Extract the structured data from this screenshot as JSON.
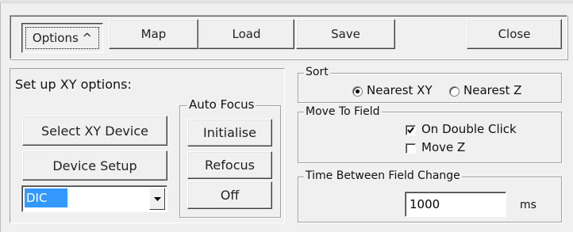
{
  "toolbar": {
    "options_label": "Options ^",
    "map_label": "Map",
    "load_label": "Load",
    "save_label": "Save",
    "close_label": "Close"
  },
  "xy_panel": {
    "heading": "Set up XY options:",
    "select_device_label": "Select XY Device",
    "device_setup_label": "Device Setup",
    "device_combo_value": "DIC"
  },
  "auto_focus": {
    "title": "Auto Focus",
    "initialise_label": "Initialise",
    "refocus_label": "Refocus",
    "off_label": "Off"
  },
  "sort": {
    "title": "Sort",
    "options": [
      {
        "label": "Nearest XY",
        "selected": true
      },
      {
        "label": "Nearest Z",
        "selected": false
      }
    ]
  },
  "move_to_field": {
    "title": "Move To Field",
    "on_double_click_label": "On Double Click",
    "on_double_click_checked": true,
    "move_z_label": "Move Z",
    "move_z_checked": false
  },
  "time_between": {
    "title": "Time Between Field Change",
    "value": "1000",
    "unit": "ms"
  },
  "icons": {
    "dropdown": "chevron-down-icon",
    "check": "checkmark-icon"
  }
}
